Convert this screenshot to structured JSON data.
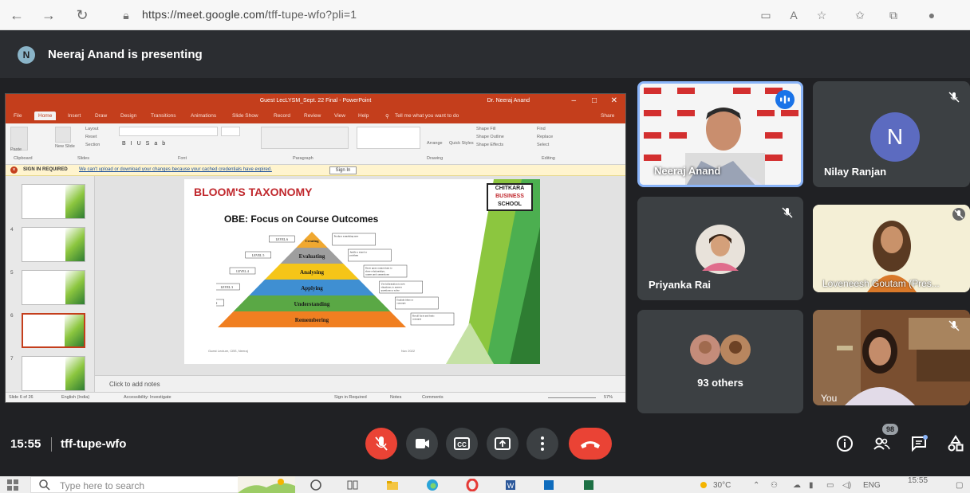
{
  "browser": {
    "url_domain": "https://meet.google.com/",
    "url_path": "tff-tupe-wfo?pli=1"
  },
  "meet": {
    "presenter_initial": "N",
    "presenting_text": "Neeraj Anand is presenting",
    "time": "15:55",
    "meeting_code": "tff-tupe-wfo",
    "participant_count": "98"
  },
  "powerpoint": {
    "window_title": "Guest LecLYSM_Sept. 22 Final - PowerPoint",
    "user": "Dr. Neeraj Anand",
    "tabs": [
      "File",
      "Home",
      "Insert",
      "Draw",
      "Design",
      "Transitions",
      "Animations",
      "Slide Show",
      "Record",
      "Review",
      "View",
      "Help"
    ],
    "tell_me": "Tell me what you want to do",
    "share": "Share",
    "ribbon_groups": [
      "Clipboard",
      "Slides",
      "Font",
      "Paragraph",
      "Drawing",
      "Editing"
    ],
    "ribbon_items": {
      "paste": "Paste",
      "new_slide": "New Slide",
      "layout": "Layout",
      "reset": "Reset",
      "section": "Section",
      "arrange": "Arrange",
      "quick_styles": "Quick Styles",
      "shape_fill": "Shape Fill",
      "shape_outline": "Shape Outline",
      "shape_effects": "Shape Effects",
      "find": "Find",
      "replace": "Replace",
      "select": "Select"
    },
    "signin_bold": "SIGN IN REQUIRED",
    "signin_msg": "We can't upload or download your changes because your cached credentials have expired.",
    "signin_button": "Sign In",
    "thumb_numbers": [
      "",
      "4",
      "5",
      "6",
      "7"
    ],
    "notes_placeholder": "Click to add notes",
    "status": {
      "slide_count": "Slide 6 of 26",
      "language": "English (India)",
      "accessibility": "Accessibility: Investigate",
      "signin_required": "Sign in Required",
      "notes": "Notes",
      "comments": "Comments",
      "zoom": "57%"
    },
    "slide": {
      "title": "BLOOM'S TAXONOMY",
      "logo_line1": "CHITKARA",
      "logo_line2": "BUSINESS",
      "logo_line3": "SCHOOL",
      "subtitle": "OBE: Focus on Course Outcomes",
      "levels": [
        {
          "label": "LEVEL 6",
          "name": "Creating",
          "color": "#f0a830"
        },
        {
          "label": "LEVEL 5",
          "name": "Evaluating",
          "color": "#9e9e9e"
        },
        {
          "label": "LEVEL 4",
          "name": "Analysing",
          "color": "#f5c518"
        },
        {
          "label": "LEVEL 3",
          "name": "Applying",
          "color": "#3f8fd2"
        },
        {
          "label": "LEVEL 2",
          "name": "Understanding",
          "color": "#5aa845"
        },
        {
          "label": "LEVEL 1",
          "name": "Remembering",
          "color": "#f07f21"
        }
      ],
      "notes_right": [
        "Produce something new",
        "Justify a stand or problem",
        "Draw upon connections to show relationships, causes and connections",
        "Use information to new situations, to answer questions or solve problems",
        "Explain ideas or concepts",
        "Recall facts and basic concepts"
      ],
      "footer_left": "Guest Lecture, CBS, Neeraj",
      "footer_right": "Nov 2022"
    }
  },
  "participants": [
    {
      "name": "Neeraj Anand",
      "speaking": true
    },
    {
      "name": "Nilay Ranjan",
      "initial": "N"
    },
    {
      "name": "Priyanka Rai"
    },
    {
      "name": "Loveneesh Goutam (Pres..."
    },
    {
      "name": "93 others"
    },
    {
      "name": "You"
    }
  ],
  "taskbar": {
    "search_placeholder": "Type here to search",
    "temperature": "30°C",
    "language": "ENG",
    "clock": "15:55"
  },
  "colors": {
    "meet_bg": "#202124",
    "tile_bg": "#3c4043",
    "end_call": "#ea4335",
    "ppt_accent": "#c43e1c",
    "avatar_n": "#5c6bc0"
  }
}
